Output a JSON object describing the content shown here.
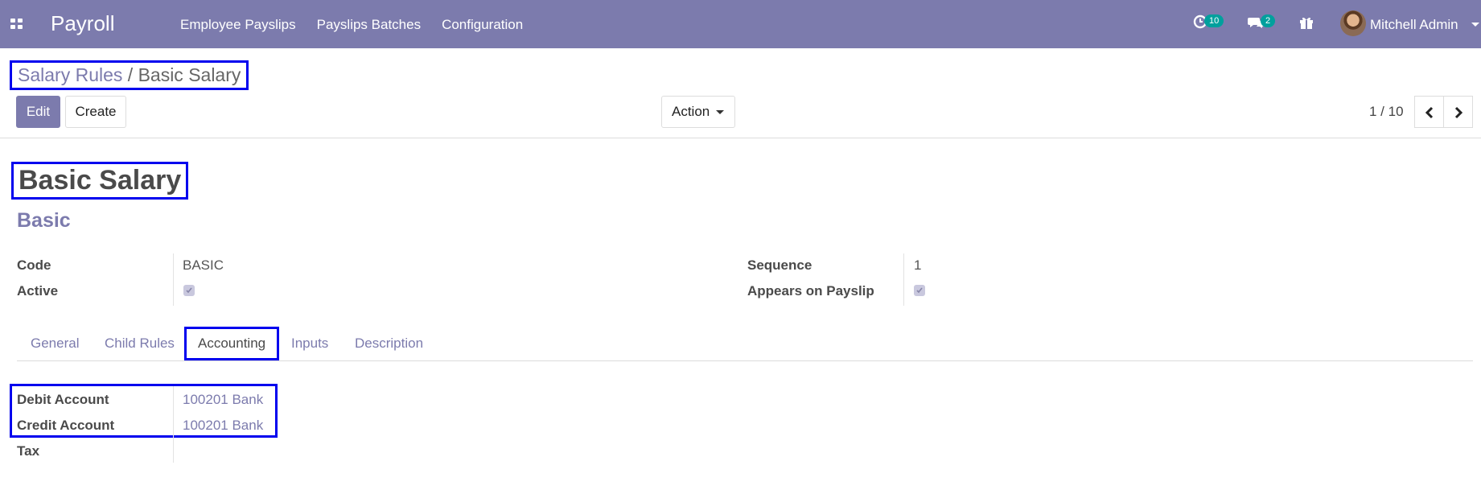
{
  "app": {
    "title": "Payroll"
  },
  "menu": [
    "Employee Payslips",
    "Payslips Batches",
    "Configuration"
  ],
  "systray": {
    "activity_count": "10",
    "messages_count": "2",
    "user_name": "Mitchell Admin"
  },
  "breadcrumb": {
    "parent": "Salary Rules",
    "separator": "/",
    "current": "Basic Salary"
  },
  "toolbar": {
    "edit_label": "Edit",
    "create_label": "Create",
    "action_label": "Action"
  },
  "pager": {
    "value": "1 / 10"
  },
  "record": {
    "name": "Basic Salary",
    "category": "Basic",
    "fields_left": [
      {
        "label": "Code",
        "value": "BASIC"
      },
      {
        "label": "Active",
        "checked": true
      }
    ],
    "fields_right": [
      {
        "label": "Sequence",
        "value": "1"
      },
      {
        "label": "Appears on Payslip",
        "checked": true
      }
    ]
  },
  "tabs": [
    "General",
    "Child Rules",
    "Accounting",
    "Inputs",
    "Description"
  ],
  "active_tab": "Accounting",
  "accounting": [
    {
      "label": "Debit Account",
      "value": "100201 Bank"
    },
    {
      "label": "Credit Account",
      "value": "100201 Bank"
    },
    {
      "label": "Tax",
      "value": ""
    }
  ],
  "colors": {
    "brand": "#7c7bad",
    "badge": "#00a09d",
    "highlight": "#0000ee"
  }
}
